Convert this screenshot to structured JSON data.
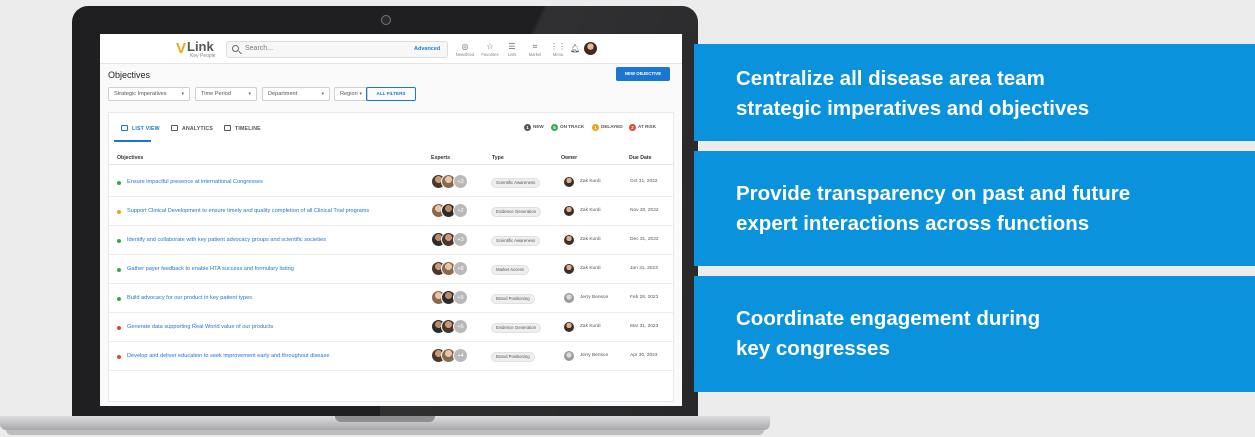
{
  "app": {
    "logo_mark": "V",
    "logo_name": "Link",
    "logo_sub": "Key People",
    "search_placeholder": "Search...",
    "advanced": "Advanced"
  },
  "nav": [
    {
      "icon": "newsfeed-icon",
      "glyph": "◎",
      "label": "Newsfeed"
    },
    {
      "icon": "favorites-icon",
      "glyph": "☆",
      "label": "Favorites"
    },
    {
      "icon": "lists-icon",
      "glyph": "☰",
      "label": "Lists"
    },
    {
      "icon": "market-icon",
      "glyph": "⌗",
      "label": "Market"
    },
    {
      "icon": "menu-icon",
      "glyph": "⋮⋮",
      "label": "Menu"
    }
  ],
  "page": {
    "title": "Objectives",
    "new_button": "NEW OBJECTIVE"
  },
  "filters": {
    "items": [
      "Strategic Imperatives",
      "Time Period",
      "Department",
      "Region"
    ],
    "all_filters": "ALL FILTERS"
  },
  "tabs": [
    "LIST VIEW",
    "ANALYTICS",
    "TIMELINE"
  ],
  "status_legend": [
    {
      "count": "1",
      "label": "NEW",
      "color": "#555555"
    },
    {
      "count": "5",
      "label": "ON TRACK",
      "color": "#3aa655"
    },
    {
      "count": "1",
      "label": "DELAYED",
      "color": "#f2a01b"
    },
    {
      "count": "2",
      "label": "AT RISK",
      "color": "#e0453a"
    }
  ],
  "table": {
    "columns": [
      "Objectives",
      "Experts",
      "Type",
      "Owner",
      "Due Date"
    ],
    "rows": [
      {
        "objective": "Ensure impactful presence at international Congresses",
        "status_color": "#3aa655",
        "extra_experts": "+3",
        "type": "Scientific Awareness",
        "owner": "Zak Kurdi",
        "due": "Oct 31, 2022"
      },
      {
        "objective": "Support Clinical Development to ensure timely and quality completion of all Clinical Trial programs",
        "status_color": "#f2a01b",
        "extra_experts": "+2",
        "type": "Evidence Generation",
        "owner": "Zak Kurdi",
        "due": "Nov 30, 2022"
      },
      {
        "objective": "Identify and collaborate with key patient advocacy groups and scientific societies",
        "status_color": "#3aa655",
        "extra_experts": "+3",
        "type": "Scientific Awareness",
        "owner": "Zak Kurdi",
        "due": "Dec 31, 2022"
      },
      {
        "objective": "Gather payer feedback to enable HTA success and formulary listing",
        "status_color": "#3aa655",
        "extra_experts": "+8",
        "type": "Market Access",
        "owner": "Zak Kurdi",
        "due": "Jan 31, 2023"
      },
      {
        "objective": "Build advocacy for our product in key patient types",
        "status_color": "#3aa655",
        "extra_experts": "+5",
        "type": "Brand Positioning",
        "owner": "Jerry Benson",
        "due": "Feb 28, 2023"
      },
      {
        "objective": "Generate data supporting Real World value of our products",
        "status_color": "#e0453a",
        "extra_experts": "+5",
        "type": "Evidence Generation",
        "owner": "Zak Kurdi",
        "due": "Mar 31, 2023"
      },
      {
        "objective": "Develop and deliver education to seek improvement early and throughout disease",
        "status_color": "#e0453a",
        "extra_experts": "+4",
        "type": "Brand Positioning",
        "owner": "Jerry Benson",
        "due": "Apr 30, 2023"
      }
    ]
  },
  "callouts": [
    [
      "Centralize all disease area team",
      "strategic imperatives and objectives"
    ],
    [
      "Provide transparency on past and future",
      "expert interactions across functions"
    ],
    [
      "Coordinate engagement during",
      "key congresses"
    ]
  ],
  "colors": {
    "accent": "#1a76d2",
    "callout_bg": "#0b92dc",
    "page_bg": "#ececec"
  }
}
